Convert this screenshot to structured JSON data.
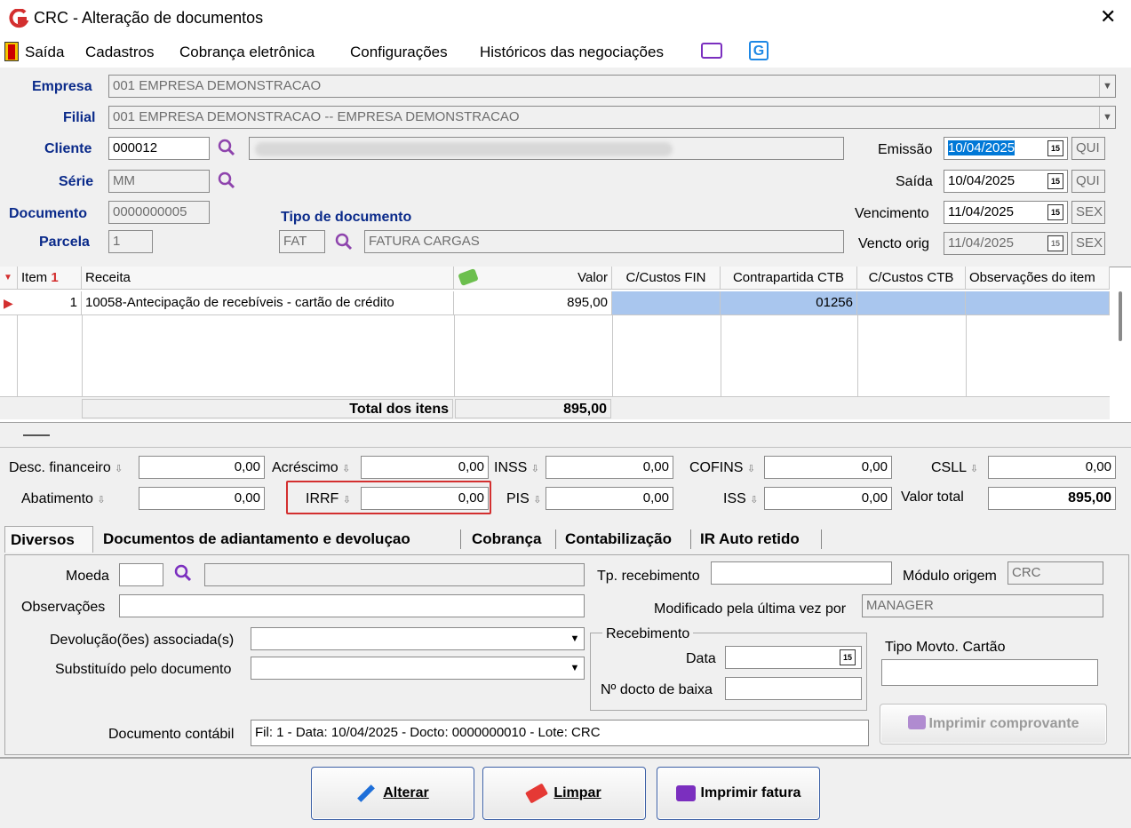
{
  "window": {
    "title": "CRC - Alteração de documentos",
    "close_icon": "close-icon"
  },
  "menu": [
    "Saída",
    "Cadastros",
    "Cobrança eletrônica",
    "Configurações",
    "Históricos das negociações"
  ],
  "header": {
    "empresa_label": "Empresa",
    "empresa_value": "001 EMPRESA DEMONSTRACAO",
    "filial_label": "Filial",
    "filial_value": "001 EMPRESA DEMONSTRACAO -- EMPRESA DEMONSTRACAO",
    "cliente_label": "Cliente",
    "cliente_value": "000012",
    "serie_label": "Série",
    "serie_value": "MM",
    "documento_label": "Documento",
    "documento_value": "0000000005",
    "parcela_label": "Parcela",
    "parcela_value": "1",
    "tipo_doc_label": "Tipo de documento",
    "tipo_doc_code": "FAT",
    "tipo_doc_desc": "FATURA CARGAS",
    "emissao_label": "Emissão",
    "emissao_value": "10/04/2025",
    "emissao_day": "QUI",
    "saida_label": "Saída",
    "saida_value": "10/04/2025",
    "saida_day": "QUI",
    "venc_label": "Vencimento",
    "venc_value": "11/04/2025",
    "venc_day": "SEX",
    "venc_orig_label": "Vencto orig",
    "venc_orig_value": "11/04/2025",
    "venc_orig_day": "SEX",
    "calendar_glyph": "15"
  },
  "grid": {
    "columns": [
      "Item",
      "Receita",
      "Valor",
      "C/Custos FIN",
      "Contrapartida CTB",
      "C/Custos CTB",
      "Observações do item"
    ],
    "rows": [
      {
        "item": "1",
        "receita": "10058-Antecipação de recebíveis - cartão de crédito",
        "valor": "895,00",
        "cc_fin": "",
        "contrapartida": "01256",
        "cc_ctb": "",
        "obs": ""
      }
    ],
    "total_label": "Total dos itens",
    "total_value": "895,00"
  },
  "totals": {
    "desc_fin_label": "Desc. financeiro",
    "desc_fin": "0,00",
    "acrescimo_label": "Acréscimo",
    "acrescimo": "0,00",
    "inss_label": "INSS",
    "inss": "0,00",
    "cofins_label": "COFINS",
    "cofins": "0,00",
    "csll_label": "CSLL",
    "csll": "0,00",
    "abatimento_label": "Abatimento",
    "abatimento": "0,00",
    "irrf_label": "IRRF",
    "irrf": "0,00",
    "pis_label": "PIS",
    "pis": "0,00",
    "iss_label": "ISS",
    "iss": "0,00",
    "valor_total_label": "Valor total",
    "valor_total": "895,00"
  },
  "tabs": [
    "Diversos",
    "Documentos de adiantamento e devoluçao",
    "Cobrança",
    "Contabilização",
    "IR Auto retido"
  ],
  "diversos": {
    "moeda_label": "Moeda",
    "observacoes_label": "Observações",
    "devolucao_label": "Devolução(ões) associada(s)",
    "substituido_label": "Substituído pelo documento",
    "tp_receb_label": "Tp. recebimento",
    "modulo_origem_label": "Módulo origem",
    "modulo_origem": "CRC",
    "modificado_label": "Modificado pela última vez por",
    "modificado": "MANAGER",
    "recebimento_group": "Recebimento",
    "data_label": "Data",
    "data_value": " /  /",
    "docto_baixa_label": "Nº docto de baixa",
    "tipo_movto_label": "Tipo Movto. Cartão",
    "imprimir_comprovante": "Imprimir comprovante",
    "doc_contabil_label": "Documento contábil",
    "doc_contabil": "Fil: 1 - Data: 10/04/2025 - Docto: 0000000010 - Lote: CRC"
  },
  "buttons": {
    "alterar": "Alterar",
    "limpar": "Limpar",
    "imprimir_fatura": "Imprimir fatura"
  },
  "colors": {
    "label_blue": "#0a2a8a",
    "selection": "#0078d7",
    "grid_row_selected": "#a9c6ee",
    "highlight_red": "#d32f2f",
    "app_red": "#d32f2f",
    "purple": "#7b2fbf"
  }
}
